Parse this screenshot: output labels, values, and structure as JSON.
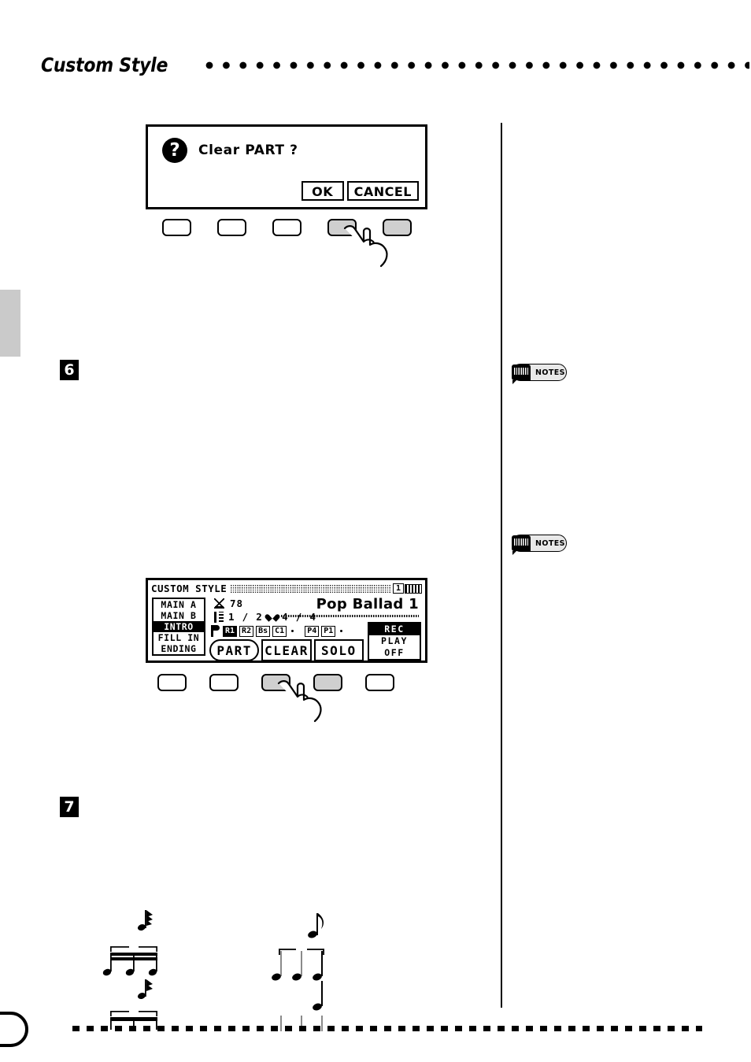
{
  "header": {
    "title": "Custom Style",
    "dots_icon": "dotted-rule"
  },
  "steps": [
    {
      "number": "6"
    },
    {
      "number": "7"
    }
  ],
  "dialog_lcd": {
    "icon": "question-mark-icon",
    "icon_glyph": "?",
    "message": "Clear PART ?",
    "buttons": [
      {
        "label": "OK"
      },
      {
        "label": "CANCEL"
      }
    ]
  },
  "button_row_1": {
    "buttons": [
      {
        "shaded": false
      },
      {
        "shaded": false
      },
      {
        "shaded": false
      },
      {
        "shaded": true
      },
      {
        "shaded": true
      }
    ],
    "pointer_icon": "hand-pointer-icon",
    "pointer_target_index": 4
  },
  "style_lcd": {
    "title": "CUSTOM STYLE",
    "hatch_icon": "hatched-bar",
    "page_number": "1",
    "level_icon": "level-bars-icon",
    "sections": [
      {
        "label": "MAIN A",
        "active": false
      },
      {
        "label": "MAIN B",
        "active": false
      },
      {
        "label": "INTRO",
        "active": true
      },
      {
        "label": "FILL IN",
        "active": false
      },
      {
        "label": "ENDING",
        "active": false
      }
    ],
    "tempo": {
      "icon": "metronome-icon",
      "value": "78"
    },
    "measure": {
      "icon": "measure-icon",
      "value": "1 / 2"
    },
    "beat": {
      "icon": "heart-icon",
      "value": "4 / 4"
    },
    "style_name": "Pop Ballad 1",
    "parts_icon": "flag-icon",
    "parts": [
      {
        "label": "R1",
        "selected": true
      },
      {
        "label": "R2",
        "selected": false
      },
      {
        "label": "Bs",
        "selected": false
      },
      {
        "label": "C1",
        "selected": false
      },
      {
        "label": "·",
        "selected": false,
        "is_dot": true
      },
      {
        "label": "P4",
        "selected": false
      },
      {
        "label": "P1",
        "selected": false
      },
      {
        "label": "·",
        "selected": false,
        "is_dot": true
      }
    ],
    "soft_buttons": [
      {
        "label": "PART",
        "shape": "oval"
      },
      {
        "label": "CLEAR",
        "shape": "rect"
      },
      {
        "label": "SOLO",
        "shape": "rect"
      }
    ],
    "rec_panel": [
      {
        "label": "REC",
        "active": true
      },
      {
        "label": "PLAY",
        "active": false
      },
      {
        "label": "OFF",
        "active": false
      }
    ]
  },
  "button_row_2": {
    "buttons": [
      {
        "shaded": false
      },
      {
        "shaded": false
      },
      {
        "shaded": true
      },
      {
        "shaded": true
      },
      {
        "shaded": false
      }
    ],
    "pointer_icon": "hand-pointer-icon",
    "pointer_target_index": 3
  },
  "notes_badges": [
    {
      "label": "NOTES",
      "icon": "keyboard-note-icon"
    },
    {
      "label": "NOTES",
      "icon": "keyboard-note-icon"
    }
  ],
  "music_examples": [
    {
      "icon": "beamed-sixteenth-notes-group"
    },
    {
      "icon": "triplet-quarter-notes-group"
    }
  ],
  "footer": {
    "rule_icon": "dashed-rule",
    "tab_icon": "page-tab-shape"
  },
  "edge_tab": {
    "icon": "section-tab-marker",
    "color": "#cacaca"
  },
  "colors": {
    "ink": "#000000",
    "paper": "#ffffff",
    "shaded_button": "#cfcfcf",
    "badge_fill": "#e9e9e9"
  }
}
